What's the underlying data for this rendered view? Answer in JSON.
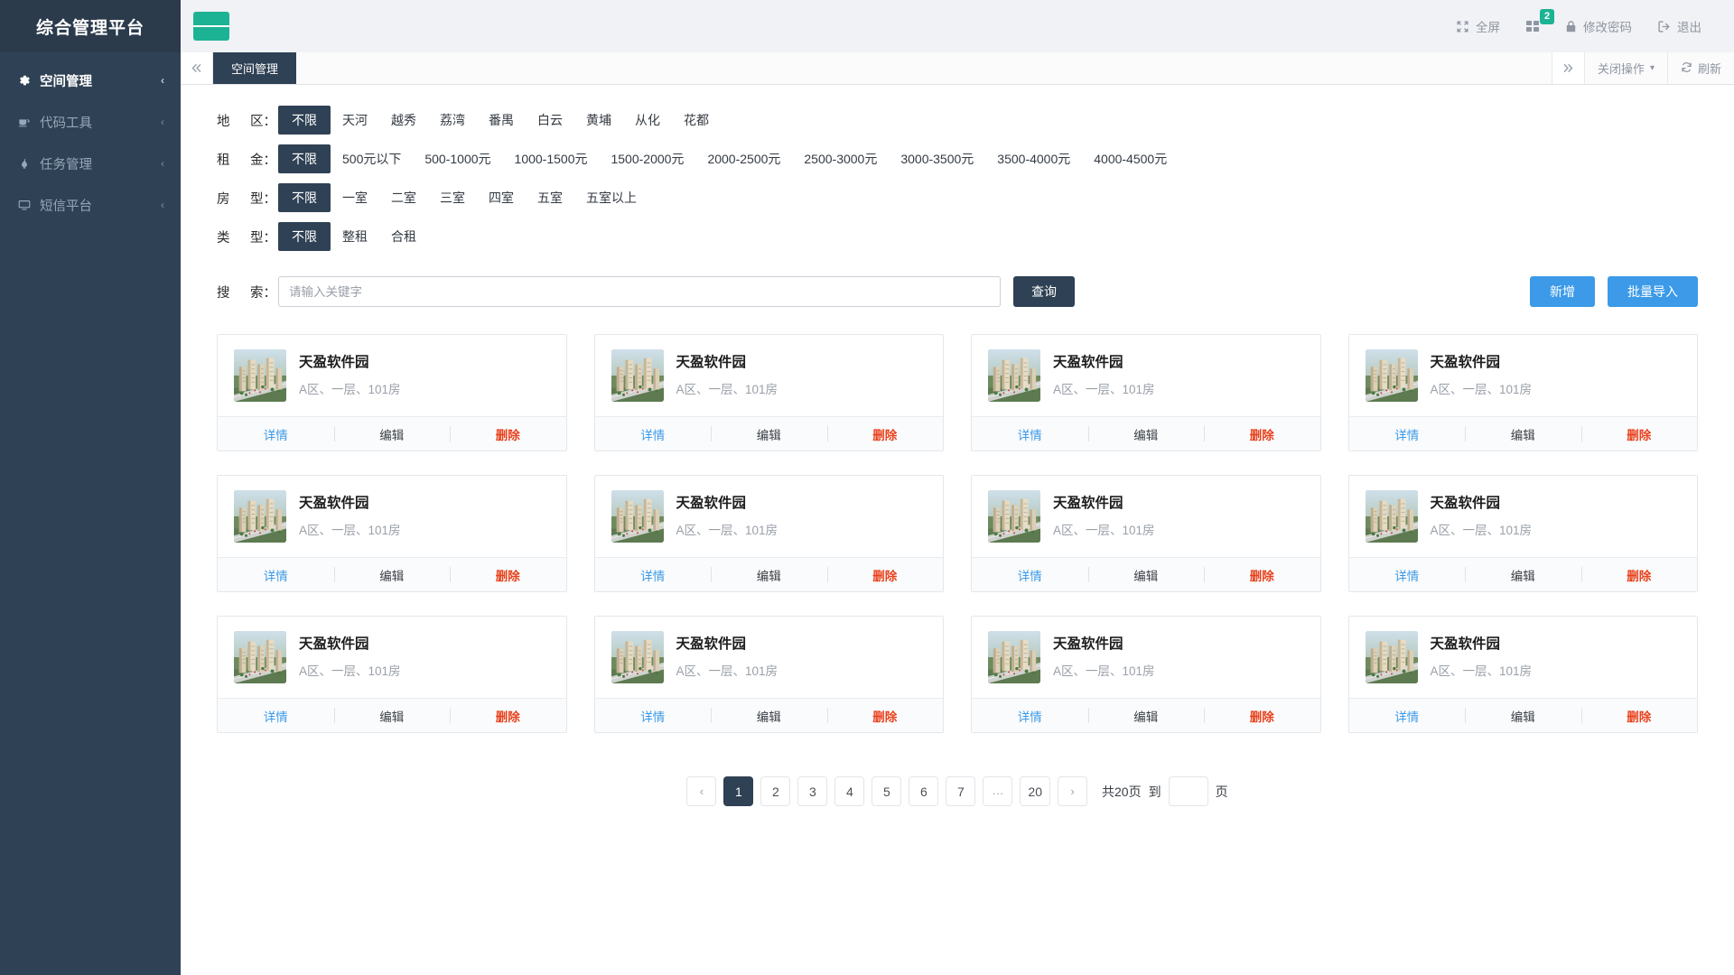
{
  "sidebar": {
    "logo": "综合管理平台",
    "items": [
      {
        "label": "空间管理",
        "icon": "gear-icon",
        "caret": "‹",
        "active": true
      },
      {
        "label": "代码工具",
        "icon": "coffee-icon",
        "caret": "‹",
        "active": false
      },
      {
        "label": "任务管理",
        "icon": "flame-icon",
        "caret": "‹",
        "active": false
      },
      {
        "label": "短信平台",
        "icon": "monitor-icon",
        "caret": "‹",
        "active": false
      }
    ]
  },
  "header": {
    "menu_toggle": "hamburger-icon",
    "items": [
      {
        "label": "全屏",
        "icon": "expand-icon",
        "badge": null
      },
      {
        "label": "",
        "icon": "grid-icon",
        "badge": "2"
      },
      {
        "label": "修改密码",
        "icon": "lock-icon",
        "badge": null
      },
      {
        "label": "退出",
        "icon": "logout-icon",
        "badge": null
      }
    ]
  },
  "tabbar": {
    "prev_icon": "double-chevron-left-icon",
    "next_icon": "double-chevron-right-icon",
    "tabs": [
      {
        "label": "空间管理",
        "active": true
      }
    ],
    "close_ops_label": "关闭操作",
    "close_ops_caret": "▾",
    "refresh_label": "刷新",
    "refresh_icon": "refresh-icon"
  },
  "filters": [
    {
      "label_a": "地",
      "label_b": "区",
      "colon": "：",
      "options": [
        "不限",
        "天河",
        "越秀",
        "荔湾",
        "番禺",
        "白云",
        "黄埔",
        "从化",
        "花都"
      ],
      "selected": "不限"
    },
    {
      "label_a": "租",
      "label_b": "金",
      "colon": "：",
      "options": [
        "不限",
        "500元以下",
        "500-1000元",
        "1000-1500元",
        "1500-2000元",
        "2000-2500元",
        "2500-3000元",
        "3000-3500元",
        "3500-4000元",
        "4000-4500元"
      ],
      "selected": "不限"
    },
    {
      "label_a": "房",
      "label_b": "型",
      "colon": "：",
      "options": [
        "不限",
        "一室",
        "二室",
        "三室",
        "四室",
        "五室",
        "五室以上"
      ],
      "selected": "不限"
    },
    {
      "label_a": "类",
      "label_b": "型",
      "colon": "：",
      "options": [
        "不限",
        "整租",
        "合租"
      ],
      "selected": "不限"
    }
  ],
  "search": {
    "label_a": "搜",
    "label_b": "索",
    "colon": "：",
    "placeholder": "请输入关键字",
    "value": "",
    "query_button": "查询",
    "add_button": "新增",
    "import_button": "批量导入"
  },
  "cards": {
    "actions": {
      "detail": "详情",
      "edit": "编辑",
      "delete": "删除"
    },
    "items": [
      {
        "title": "天盈软件园",
        "subtitle": "A区、一层、101房"
      },
      {
        "title": "天盈软件园",
        "subtitle": "A区、一层、101房"
      },
      {
        "title": "天盈软件园",
        "subtitle": "A区、一层、101房"
      },
      {
        "title": "天盈软件园",
        "subtitle": "A区、一层、101房"
      },
      {
        "title": "天盈软件园",
        "subtitle": "A区、一层、101房"
      },
      {
        "title": "天盈软件园",
        "subtitle": "A区、一层、101房"
      },
      {
        "title": "天盈软件园",
        "subtitle": "A区、一层、101房"
      },
      {
        "title": "天盈软件园",
        "subtitle": "A区、一层、101房"
      },
      {
        "title": "天盈软件园",
        "subtitle": "A区、一层、101房"
      },
      {
        "title": "天盈软件园",
        "subtitle": "A区、一层、101房"
      },
      {
        "title": "天盈软件园",
        "subtitle": "A区、一层、101房"
      },
      {
        "title": "天盈软件园",
        "subtitle": "A区、一层、101房"
      }
    ]
  },
  "pagination": {
    "prev": "‹",
    "next": "›",
    "pages": [
      "1",
      "2",
      "3",
      "4",
      "5",
      "6",
      "7"
    ],
    "ellipsis": "···",
    "last_page": "20",
    "current": "1",
    "total_text": "共20页",
    "to_label": "到",
    "jump_value": "",
    "unit": "页"
  },
  "colors": {
    "sidebar_bg": "#2f4154",
    "accent_green": "#1cb394",
    "accent_blue": "#3c9ae8",
    "danger_red": "#e8411c"
  }
}
